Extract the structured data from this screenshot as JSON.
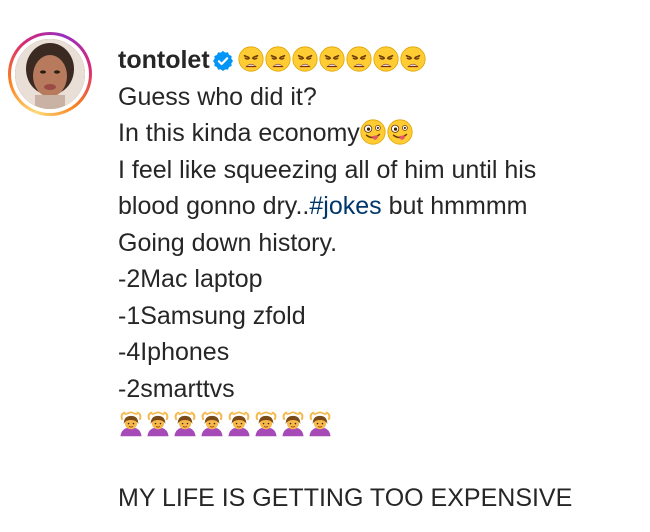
{
  "post": {
    "username": "tontolet",
    "verified": true,
    "avatar_icon": "profile-photo",
    "title_emoji": "weary-face",
    "title_emoji_count": 7,
    "lines": {
      "l1": "Guess who did it?",
      "l2": "In this kinda economy",
      "l2_emoji": "zany-face",
      "l3": "I feel like squeezing all of him until his",
      "l4_pre": "blood gonno dry..",
      "l4_hashtag": "#jokes",
      "l4_post": " but hmmmm",
      "l5": "Going down history.",
      "l6": "-2Mac laptop",
      "l7": "-1Samsung zfold",
      "l8": "-4Iphones",
      "l9": "-2smarttvs",
      "l10_emoji": "woman-gesturing-ok",
      "l12": "MY LIFE IS GETTING TOO EXPENSIVE"
    },
    "colors": {
      "text": "#262626",
      "hashtag": "#00376b",
      "verified": "#0095f6"
    }
  }
}
